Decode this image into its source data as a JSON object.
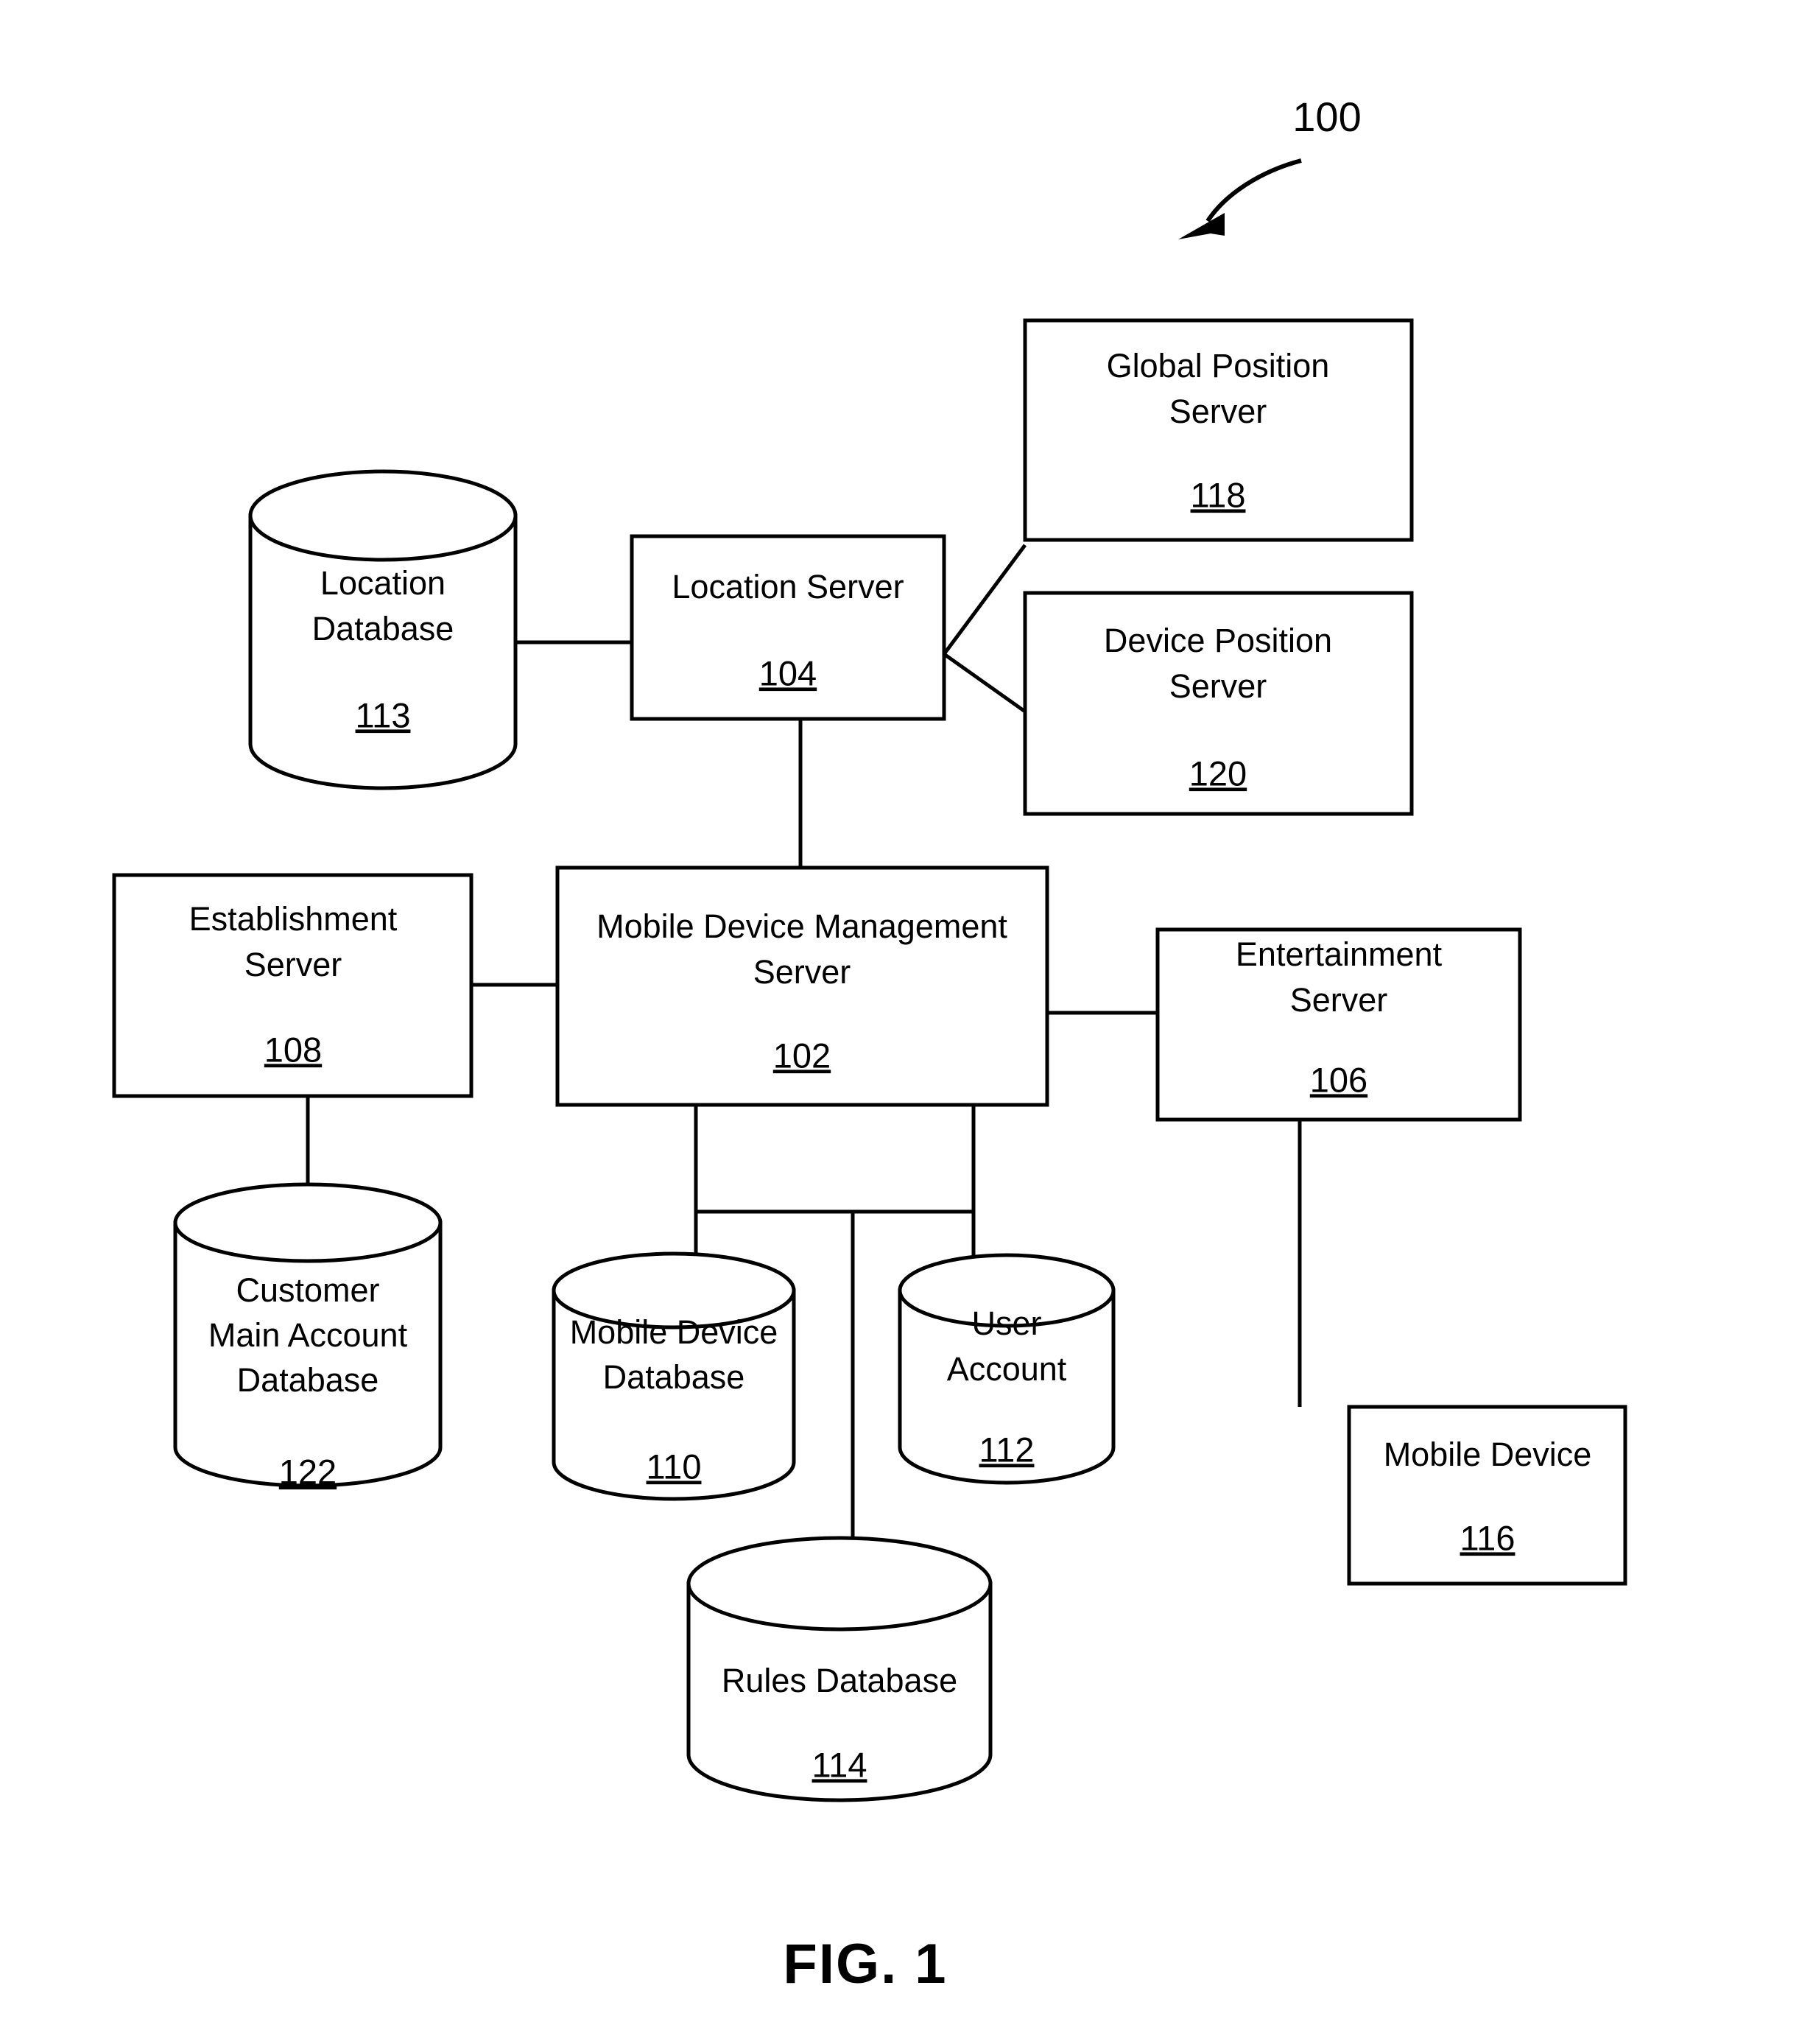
{
  "figure": {
    "caption": "FIG. 1",
    "system_reference": "100"
  },
  "nodes": {
    "location_database": {
      "label_line1": "Location",
      "label_line2": "Database",
      "ref": "113",
      "shape": "cylinder"
    },
    "location_server": {
      "label_line1": "Location Server",
      "label_line2": "",
      "ref": "104",
      "shape": "rect"
    },
    "global_position_server": {
      "label_line1": "Global Position",
      "label_line2": "Server",
      "ref": "118",
      "shape": "rect"
    },
    "device_position_server": {
      "label_line1": "Device Position",
      "label_line2": "Server",
      "ref": "120",
      "shape": "rect"
    },
    "establishment_server": {
      "label_line1": "Establishment",
      "label_line2": "Server",
      "ref": "108",
      "shape": "rect"
    },
    "mobile_device_management_server": {
      "label_line1": "Mobile Device Management",
      "label_line2": "Server",
      "ref": "102",
      "shape": "rect"
    },
    "entertainment_server": {
      "label_line1": "Entertainment",
      "label_line2": "Server",
      "ref": "106",
      "shape": "rect"
    },
    "customer_main_account_database": {
      "label_line1": "Customer",
      "label_line2": "Main Account",
      "label_line3": "Database",
      "ref": "122",
      "shape": "cylinder"
    },
    "mobile_device_database": {
      "label_line1": "Mobile Device",
      "label_line2": "Database",
      "ref": "110",
      "shape": "cylinder"
    },
    "user_account": {
      "label_line1": "User",
      "label_line2": "Account",
      "ref": "112",
      "shape": "cylinder"
    },
    "rules_database": {
      "label_line1": "Rules Database",
      "label_line2": "",
      "ref": "114",
      "shape": "cylinder"
    },
    "mobile_device": {
      "label_line1": "Mobile Device",
      "label_line2": "",
      "ref": "116",
      "shape": "rect"
    }
  },
  "connections": [
    {
      "from": "location_database",
      "to": "location_server"
    },
    {
      "from": "location_server",
      "to": "global_position_server"
    },
    {
      "from": "location_server",
      "to": "device_position_server"
    },
    {
      "from": "location_server",
      "to": "mobile_device_management_server"
    },
    {
      "from": "establishment_server",
      "to": "mobile_device_management_server"
    },
    {
      "from": "establishment_server",
      "to": "customer_main_account_database"
    },
    {
      "from": "mobile_device_management_server",
      "to": "entertainment_server"
    },
    {
      "from": "mobile_device_management_server",
      "to": "mobile_device_database"
    },
    {
      "from": "mobile_device_management_server",
      "to": "user_account"
    },
    {
      "from": "mobile_device_management_server",
      "to": "rules_database"
    },
    {
      "from": "entertainment_server",
      "to": "mobile_device"
    }
  ],
  "style": {
    "line_color": "#000000",
    "background_color": "#ffffff",
    "text_color": "#000000"
  }
}
